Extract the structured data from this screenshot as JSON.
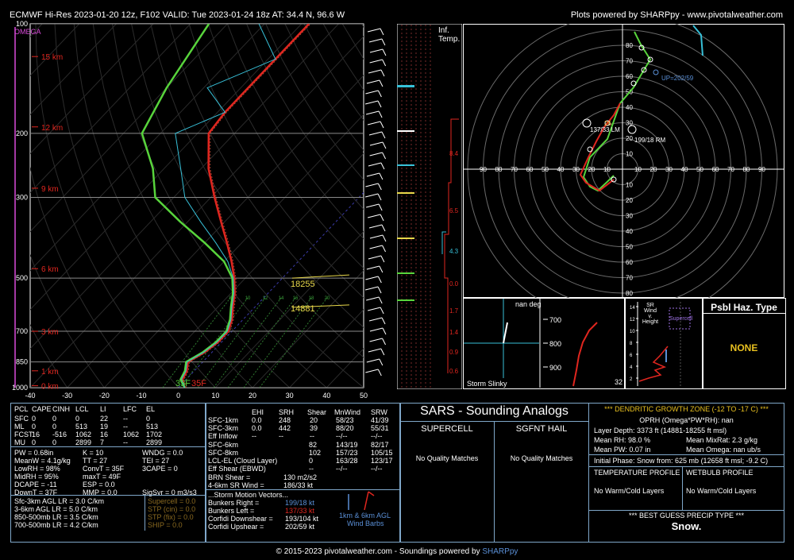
{
  "header": {
    "title": "ECMWF Hi-Res 2023-01-20 12z, F102  VALID: Tue 2023-01-24 18z  AT: 34.4 N, 96.6 W",
    "credit": "Plots powered by SHARPpy - www.pivotalweather.com"
  },
  "footer": {
    "copyright": "© 2015-2023 pivotalweather.com - Soundings powered by ",
    "sharppy": "SHARPpy"
  },
  "skewt": {
    "omega_label": "OMEGA",
    "pressure_ticks": [
      "100",
      "200",
      "300",
      "500",
      "700",
      "850",
      "1000"
    ],
    "height_labels": [
      "15 km",
      "12 km",
      "9 km",
      "6 km",
      "3 km",
      "1 km",
      "0 km"
    ],
    "temp_ticks": [
      "-40",
      "-30",
      "-20",
      "-10",
      "0",
      "10",
      "20",
      "30",
      "40",
      "50"
    ],
    "level_labels": [
      "18255",
      "14881"
    ],
    "sfc_labels": [
      "35F",
      "35F"
    ],
    "mix_ticks": [
      "8",
      "10",
      "12",
      "14",
      "16",
      "18",
      "20"
    ]
  },
  "infl_temp": {
    "title_line1": "Inf.",
    "title_line2": "Temp.",
    "values": [
      "8.4",
      "6.5",
      "4.3",
      "0.0",
      "1.7",
      "1.4",
      "0.9",
      "0.6"
    ]
  },
  "hodograph": {
    "ring_labels": [
      "10",
      "20",
      "30",
      "40",
      "50",
      "60",
      "70",
      "80",
      "90"
    ],
    "up_label": "UP=202/59",
    "lm_label": "137/33 LM",
    "rm_label": "199/18 RM",
    "lm_extra": "26"
  },
  "thermo": {
    "header": [
      "PCL",
      "CAPE",
      "CINH",
      "LCL",
      "LI",
      "LFC",
      "EL"
    ],
    "rows": [
      [
        "SFC",
        "0",
        "0",
        "0",
        "22",
        "--",
        "0"
      ],
      [
        "ML",
        "0",
        "0",
        "513",
        "19",
        "--",
        "513"
      ],
      [
        "FCST",
        "16",
        "-516",
        "1062",
        "16",
        "1062",
        "1702"
      ],
      [
        "MU",
        "0",
        "0",
        "2899",
        "7",
        "--",
        "2899"
      ]
    ],
    "left_col": [
      "PW = 0.68in",
      "MeanW = 4.1g/kg",
      "LowRH = 98%",
      "MidRH = 95%",
      "DCAPE = -11",
      "DownT = 37F"
    ],
    "mid_col": [
      "K = 10",
      "TT = 27",
      "ConvT = 35F",
      "maxT = 49F",
      "ESP = 0.0",
      "MMP = 0.0"
    ],
    "right_col": [
      "WNDG = 0.0",
      "TEI = 27",
      "3CAPE = 0",
      "",
      "",
      "SigSvr = 0 m3/s3"
    ],
    "lapse": [
      "Sfc-3km AGL LR = 3.0 C/km",
      "3-6km AGL LR = 5.0 C/km",
      "850-500mb LR = 3.5 C/km",
      "700-500mb LR = 4.2 C/km"
    ],
    "composites": [
      "Supercell = 0.0",
      "STP (cin) = 0.0",
      "STP (fix) = 0.0",
      "SHIP = 0.0"
    ]
  },
  "kinematic": {
    "header": [
      "EHI",
      "SRH",
      "Shear",
      "MnWind",
      "SRW"
    ],
    "rows": [
      [
        "SFC-1km",
        "0.0",
        "248",
        "20",
        "58/23",
        "41/39"
      ],
      [
        "SFC-3km",
        "0.0",
        "442",
        "39",
        "88/20",
        "55/31"
      ],
      [
        "Eff Inflow",
        "--",
        "--",
        "--",
        "--/--",
        "--/--"
      ],
      [
        "",
        "",
        " ",
        "",
        "",
        ""
      ],
      [
        "SFC-6km",
        "",
        "82",
        "143/19",
        "82/17",
        ""
      ],
      [
        "SFC-8km",
        "",
        "102",
        "157/23",
        "105/15",
        ""
      ],
      [
        "LCL-EL (Cloud Layer)",
        "",
        "0",
        "163/28",
        "123/17",
        ""
      ],
      [
        "Eff Shear (EBWD)",
        "",
        "--",
        "--/--",
        "--/--",
        ""
      ]
    ],
    "brn": "BRN Shear =",
    "brn_val": "130 m2/s2",
    "srwind": "4-6km SR Wind =",
    "srwind_val": "186/33 kt",
    "storm_motion": "...Storm Motion Vectors...",
    "bunkers_right": "Bunkers Right =",
    "bunkers_right_val": "199/18 kt",
    "bunkers_left": "Bunkers Left =",
    "bunkers_left_val": "137/33 kt",
    "corfidi_down": "Corfidi Downshear =",
    "corfidi_down_val": "193/104 kt",
    "corfidi_up": "Corfidi Upshear =",
    "corfidi_up_val": "202/59 kt",
    "barb_legend1": "1km & 6km AGL",
    "barb_legend2": "Wind Barbs"
  },
  "sars": {
    "title": "SARS - Sounding Analogs",
    "supercell": "SUPERCELL",
    "sgfnt_hail": "SGFNT HAIL",
    "no_match": "No Quality Matches"
  },
  "dgz": {
    "title": "*** DENDRITIC GROWTH ZONE (-12 TO -17 C) ***",
    "oprh": "OPRH (Omega*PW*RH): nan",
    "depth": "Layer Depth: 3373 ft (14881-18255 ft msl)",
    "mean_rh": "Mean RH: 98.0 %",
    "mean_mix": "Mean MixRat: 2.3 g/kg",
    "mean_pw": "Mean PW: 0.07 in",
    "mean_omega": "Mean Omega: nan ub/s",
    "initial_phase": "Initial Phase: Snow from: 625 mb (12658 ft msl; -9.2 C)",
    "temp_profile": "TEMPERATURE PROFILE",
    "wetbulb_profile": "WETBULB PROFILE",
    "no_warm": "No Warm/Cold Layers",
    "best_guess": "*** BEST GUESS PRECIP TYPE ***",
    "precip": "Snow."
  },
  "small_panels": {
    "omega_title": "nan deg",
    "storm_slinky": "Storm Slinky",
    "slinky_ticks": [
      "700",
      "800",
      "900"
    ],
    "slinky_extra": "32",
    "srwind_title1": "SR Wind",
    "srwind_title2": "v.",
    "srwind_title3": "Height",
    "supercell_label": "Supercell",
    "srwind_ticks": [
      "14",
      "12",
      "10",
      "8",
      "6",
      "4",
      "2"
    ],
    "psbl_title": "Psbl Haz. Type",
    "psbl_value": "NONE"
  },
  "chart_data": {
    "type": "line",
    "title": "ECMWF Hi-Res 2023-01-20 12z, F102  VALID: Tue 2023-01-24 18z  AT: 34.4 N, 96.6 W",
    "xlabel": "",
    "ylabel": "",
    "xlim": [
      -40,
      50
    ],
    "ylim": [
      1000,
      100
    ],
    "yscale": "log",
    "x_skew": true,
    "series": [
      {
        "values": [
          [
            1000,
            1.7
          ],
          [
            950,
            -1
          ],
          [
            900,
            -2
          ],
          [
            850,
            -4
          ],
          [
            800,
            -2
          ],
          [
            750,
            -1
          ],
          [
            700,
            -1
          ],
          [
            650,
            -3
          ],
          [
            600,
            -6
          ],
          [
            550,
            -9
          ],
          [
            500,
            -13
          ],
          [
            450,
            -18
          ],
          [
            400,
            -24
          ],
          [
            350,
            -31
          ],
          [
            300,
            -39
          ],
          [
            250,
            -48
          ],
          [
            200,
            -57
          ],
          [
            175,
            -58
          ],
          [
            150,
            -58
          ],
          [
            125,
            -58
          ],
          [
            100,
            -58
          ]
        ]
      },
      {
        "values": [
          [
            1000,
            1.7
          ],
          [
            950,
            -1.5
          ],
          [
            900,
            -2.5
          ],
          [
            850,
            -4.5
          ],
          [
            800,
            -2.5
          ],
          [
            750,
            -1.5
          ],
          [
            700,
            -1.5
          ],
          [
            650,
            -3.5
          ],
          [
            600,
            -6.5
          ],
          [
            550,
            -9.5
          ],
          [
            500,
            -13.5
          ],
          [
            450,
            -20
          ],
          [
            400,
            -30
          ],
          [
            350,
            -42
          ],
          [
            300,
            -55
          ],
          [
            250,
            -63
          ],
          [
            200,
            -75
          ],
          [
            150,
            -80
          ],
          [
            100,
            -85
          ]
        ]
      }
    ]
  },
  "colors": {
    "temperature": "#e0261f",
    "dewpoint": "#58d43c",
    "accent": "#7fa7c9",
    "white": "#ffffff",
    "omega": "#d94bd9",
    "cyan": "#37c0d8",
    "yellow": "#e8d84a"
  }
}
